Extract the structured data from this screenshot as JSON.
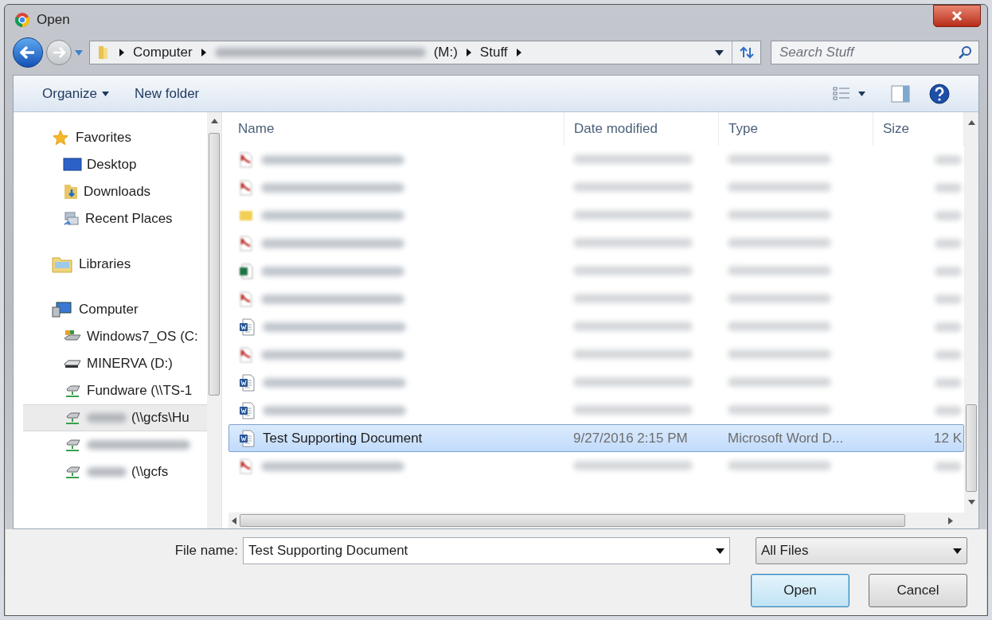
{
  "window": {
    "title": "Open"
  },
  "address": {
    "segments": [
      {
        "label": "Computer",
        "redacted": false
      },
      {
        "label": "(M:)",
        "redacted": true
      },
      {
        "label": "Stuff",
        "redacted": false
      }
    ]
  },
  "search": {
    "placeholder": "Search Stuff"
  },
  "toolbar": {
    "buttons": [
      {
        "label": "Organize",
        "dropdown": true
      },
      {
        "label": "New folder",
        "dropdown": false
      }
    ]
  },
  "sidebar": {
    "groups": [
      {
        "label": "Favorites",
        "kind": "star",
        "children": [
          {
            "label": "Desktop",
            "kind": "desktop",
            "redacted": false,
            "selected": false
          },
          {
            "label": "Downloads",
            "kind": "downloads",
            "redacted": false,
            "selected": false
          },
          {
            "label": "Recent Places",
            "kind": "recent",
            "redacted": false,
            "selected": false
          }
        ]
      },
      {
        "label": "Libraries",
        "kind": "libraries"
      },
      {
        "label": "Computer",
        "kind": "computer",
        "children": [
          {
            "label": "Windows7_OS (C:",
            "kind": "os",
            "redacted": false,
            "selected": false
          },
          {
            "label": "MINERVA (D:)",
            "kind": "drive",
            "redacted": false,
            "selected": false
          },
          {
            "label": "Fundware (\\\\TS-1",
            "kind": "network",
            "redacted": false,
            "selected": false
          },
          {
            "label": "(\\\\gcfs\\Hu",
            "kind": "network",
            "redacted": true,
            "selected": true
          },
          {
            "kind": "network",
            "redacted": true,
            "selected": false
          },
          {
            "label": "(\\\\gcfs",
            "kind": "network",
            "redacted": true,
            "selected": false
          }
        ]
      }
    ]
  },
  "table": {
    "columns": [
      "Name",
      "Date modified",
      "Type",
      "Size"
    ],
    "rows": [
      {
        "kind": "pdf",
        "blurred": true,
        "selected": false
      },
      {
        "kind": "pdf",
        "blurred": true,
        "selected": false
      },
      {
        "kind": "item",
        "blurred": true,
        "selected": false
      },
      {
        "kind": "pdf",
        "blurred": true,
        "selected": false
      },
      {
        "kind": "excel",
        "blurred": true,
        "selected": false
      },
      {
        "kind": "pdf",
        "blurred": true,
        "selected": false
      },
      {
        "kind": "word",
        "blurred": true,
        "selected": false
      },
      {
        "kind": "pdf",
        "blurred": true,
        "selected": false
      },
      {
        "kind": "word",
        "blurred": true,
        "selected": false
      },
      {
        "kind": "word",
        "blurred": true,
        "selected": false
      },
      {
        "kind": "word",
        "blurred": false,
        "selected": true,
        "name": "Test Supporting Document",
        "date": "9/27/2016 2:15 PM",
        "type": "Microsoft Word D...",
        "size": "12 K"
      },
      {
        "kind": "pdf",
        "blurred": true,
        "selected": false
      }
    ]
  },
  "footer": {
    "file_name_label": "File name:",
    "file_name": "Test Supporting Document",
    "filter": "All Files",
    "buttons": [
      {
        "label": "Open",
        "default": true
      },
      {
        "label": "Cancel",
        "default": false
      }
    ]
  }
}
